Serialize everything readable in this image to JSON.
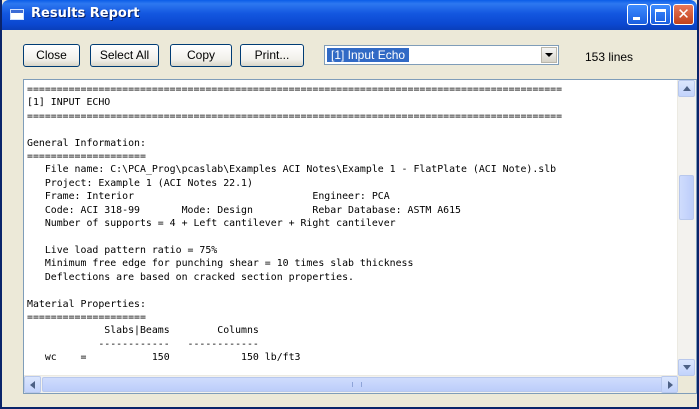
{
  "window": {
    "title": "Results Report"
  },
  "toolbar": {
    "close_label": "Close",
    "select_all_label": "Select All",
    "copy_label": "Copy",
    "print_label": "Print...",
    "section_selected": "[1] Input Echo",
    "line_count": "153 lines"
  },
  "report": {
    "lines": [
      "==========================================================================================",
      "[1] INPUT ECHO",
      "==========================================================================================",
      "",
      "General Information:",
      "====================",
      "   File name: C:\\PCA_Prog\\pcaslab\\Examples ACI Notes\\Example 1 - FlatPlate (ACI Note).slb",
      "   Project: Example 1 (ACI Notes 22.1)",
      "   Frame: Interior                              Engineer: PCA",
      "   Code: ACI 318-99       Mode: Design          Rebar Database: ASTM A615",
      "   Number of supports = 4 + Left cantilever + Right cantilever",
      "",
      "   Live load pattern ratio = 75%",
      "   Minimum free edge for punching shear = 10 times slab thickness",
      "   Deflections are based on cracked section properties.",
      "",
      "Material Properties:",
      "====================",
      "             Slabs|Beams        Columns",
      "            ------------   ------------",
      "   wc    =           150            150 lb/ft3"
    ]
  }
}
